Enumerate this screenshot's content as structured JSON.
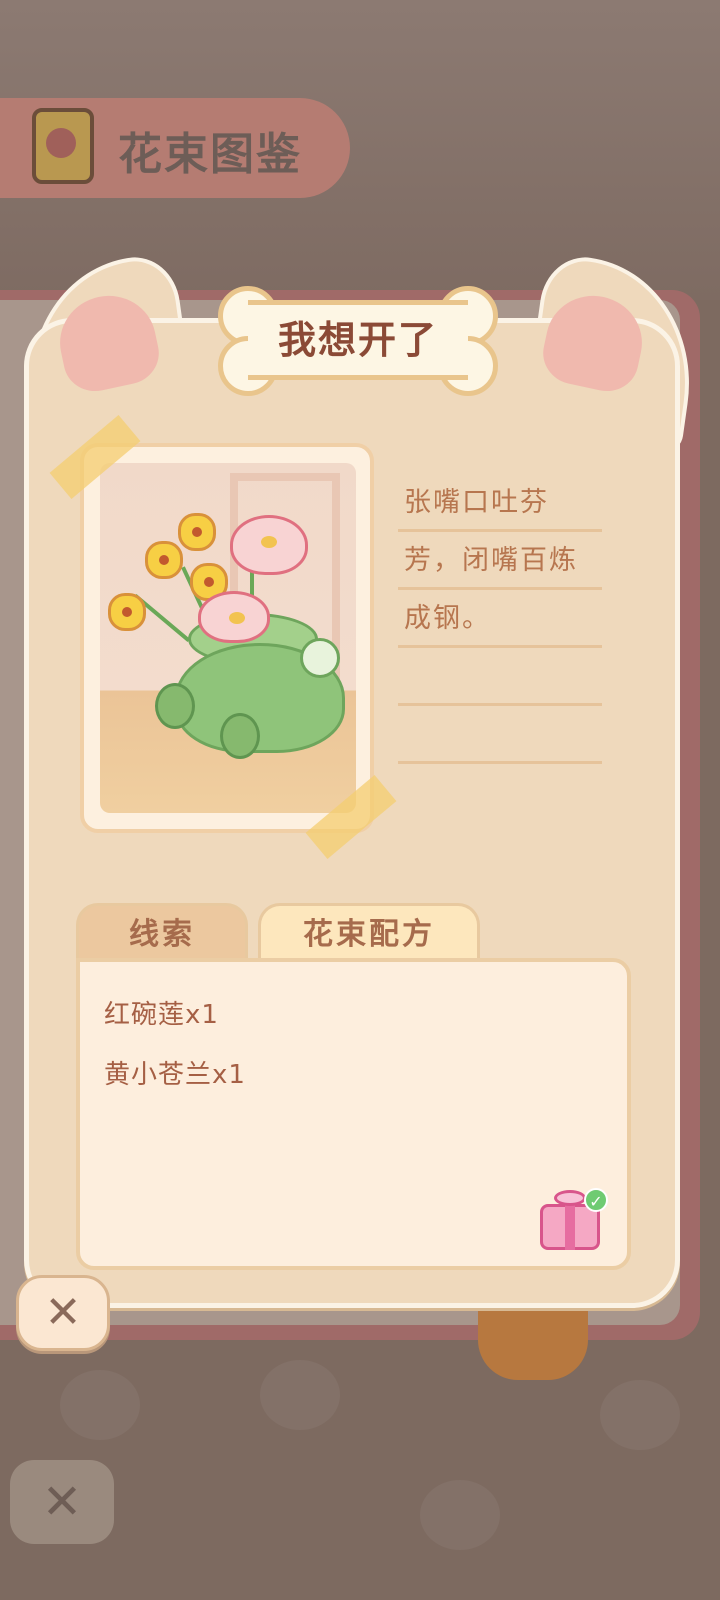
{
  "background": {
    "header_title": "花束图鉴",
    "close_glyph": "✕"
  },
  "card": {
    "title": "我想开了",
    "description_lines": [
      "张嘴口吐芬",
      "芳，闭嘴百炼",
      "成钢。",
      "",
      ""
    ],
    "tabs": [
      {
        "label": "线索",
        "active": false
      },
      {
        "label": "花束配方",
        "active": true
      }
    ],
    "recipe": [
      "红碗莲x1",
      "黄小苍兰x1"
    ],
    "reward_icon": "gift-icon",
    "reward_claimed": true,
    "close_glyph": "✕"
  },
  "colors": {
    "card_bg": "#efd9bc",
    "title_text": "#8b4a36",
    "accent_pink": "#f0b9ae"
  }
}
